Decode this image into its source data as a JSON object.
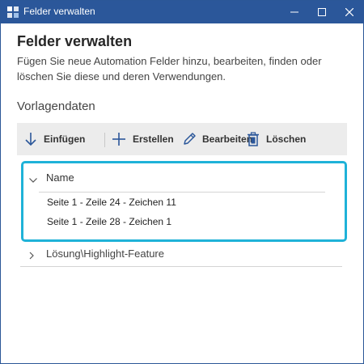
{
  "window": {
    "title": "Felder verwalten"
  },
  "main": {
    "heading": "Felder verwalten",
    "description": "Fügen Sie neue Automation Felder hinzu, bearbeiten, finden oder löschen Sie diese und deren Verwendungen.",
    "section_label": "Vorlagendaten"
  },
  "toolbar": {
    "insert_label": "Einfügen",
    "create_label": "Erstellen",
    "edit_label": "Bearbeiten",
    "delete_label": "Löschen"
  },
  "tree": {
    "group": {
      "title": "Name",
      "items": [
        "Seite 1 - Zeile 24 - Zeichen 11",
        "Seite 1 - Zeile 28 - Zeichen 1"
      ]
    },
    "collapsed_item": "Lösung\\Highlight-Feature"
  },
  "colors": {
    "titlebar": "#2b579a",
    "highlight_border": "#1fb2d8",
    "toolbar_bg": "#ececec",
    "icon": "#2b579a"
  },
  "icons": {
    "app": "app-icon",
    "minimize": "minimize-icon",
    "maximize": "maximize-icon",
    "close": "close-icon",
    "insert": "arrow-down-icon",
    "create": "plus-icon",
    "edit": "pencil-icon",
    "delete": "trash-icon",
    "expanded": "chevron-down-icon",
    "collapsed": "chevron-right-icon"
  }
}
